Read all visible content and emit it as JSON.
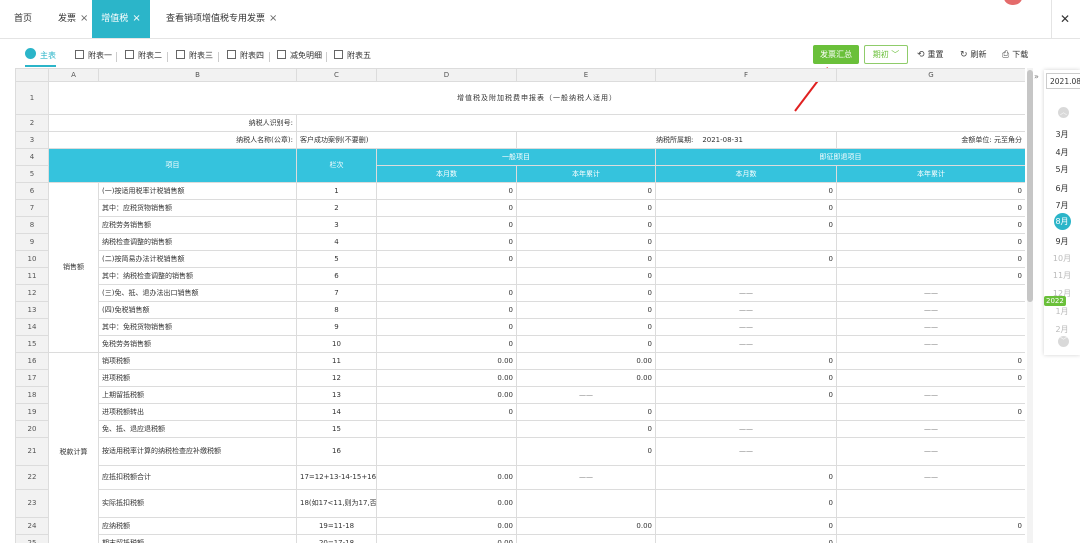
{
  "tabs": [
    {
      "label": "首页",
      "closable": false
    },
    {
      "label": "发票",
      "closable": true
    },
    {
      "label": "增值税",
      "closable": true,
      "active": true
    },
    {
      "label": "查看销项增值税专用发票",
      "closable": true
    }
  ],
  "window_close": "✕",
  "sheet_tabs": [
    "主表",
    "附表一",
    "附表二",
    "附表三",
    "附表四",
    "减免明细",
    "附表五"
  ],
  "actions": {
    "summary": "发票汇总",
    "period": "期初",
    "reset": "重置",
    "refresh": "刷新",
    "download": "下载"
  },
  "col_letters": [
    "A",
    "B",
    "C",
    "D",
    "E",
    "F",
    "G"
  ],
  "form": {
    "title": "增值税及附加税费申报表（一般纳税人适用）",
    "taxpayer_id_label": "纳税人识别号:",
    "taxpayer_name_label": "纳税人名称(公章):",
    "taxpayer_name": "客户成功案例(不要删)",
    "period_label": "纳税所属期:",
    "period": "2021-08-31",
    "unit_label": "金额单位: 元至角分"
  },
  "headers": {
    "item": "项目",
    "col_no": "栏次",
    "general": "一般项目",
    "immediate": "即征即退项目",
    "month": "本月数",
    "year": "本年累计"
  },
  "groups": {
    "sales": "销售额",
    "tax_calc": "税款计算"
  },
  "rows": [
    {
      "n": "6",
      "item": "(一)按适用税率计税销售额",
      "col": "1",
      "d": "0",
      "e": "0",
      "f": "0",
      "g": "0"
    },
    {
      "n": "7",
      "item": "其中：应税货物销售额",
      "col": "2",
      "d": "0",
      "e": "0",
      "f": "0",
      "g": "0"
    },
    {
      "n": "8",
      "item": "应税劳务销售额",
      "col": "3",
      "d": "0",
      "e": "0",
      "f": "0",
      "g": "0"
    },
    {
      "n": "9",
      "item": "纳税检查调整的销售额",
      "col": "4",
      "d": "0",
      "e": "0",
      "f": "",
      "g": "0"
    },
    {
      "n": "10",
      "item": "(二)按简易办法计税销售额",
      "col": "5",
      "d": "0",
      "e": "0",
      "f": "0",
      "g": "0"
    },
    {
      "n": "11",
      "item": "其中：纳税检查调整的销售额",
      "col": "6",
      "d": "",
      "e": "0",
      "f": "",
      "g": "0"
    },
    {
      "n": "12",
      "item": "(三)免、抵、退办法出口销售额",
      "col": "7",
      "d": "0",
      "e": "0",
      "f": "——",
      "g": "——"
    },
    {
      "n": "13",
      "item": "(四)免税销售额",
      "col": "8",
      "d": "0",
      "e": "0",
      "f": "——",
      "g": "——"
    },
    {
      "n": "14",
      "item": "其中：免税货物销售额",
      "col": "9",
      "d": "0",
      "e": "0",
      "f": "——",
      "g": "——"
    },
    {
      "n": "15",
      "item": "免税劳务销售额",
      "col": "10",
      "d": "0",
      "e": "0",
      "f": "——",
      "g": "——"
    },
    {
      "n": "16",
      "item": "销项税额",
      "col": "11",
      "d": "0.00",
      "e": "0.00",
      "f": "0",
      "g": "0"
    },
    {
      "n": "17",
      "item": "进项税额",
      "col": "12",
      "d": "0.00",
      "e": "0.00",
      "f": "0",
      "g": "0"
    },
    {
      "n": "18",
      "item": "上期留抵税额",
      "col": "13",
      "d": "0.00",
      "e": "——",
      "f": "0",
      "g": "——"
    },
    {
      "n": "19",
      "item": "进项税额转出",
      "col": "14",
      "d": "0",
      "e": "0",
      "f": "",
      "g": "0"
    },
    {
      "n": "20",
      "item": "免、抵、退应退税额",
      "col": "15",
      "d": "",
      "e": "0",
      "f": "——",
      "g": "——"
    },
    {
      "n": "21",
      "item": "按适用税率计算的纳税检查应补缴税额",
      "col": "16",
      "d": "",
      "e": "0",
      "f": "——",
      "g": "——"
    },
    {
      "n": "22",
      "item": "应抵扣税额合计",
      "col": "17=12+13-14-15+16",
      "d": "0.00",
      "e": "——",
      "f": "0",
      "g": "——"
    },
    {
      "n": "23",
      "item": "实际抵扣税额",
      "col": "18(如17<11,则为17,否则为11)",
      "d": "0.00",
      "e": "",
      "f": "0",
      "g": ""
    },
    {
      "n": "24",
      "item": "应纳税额",
      "col": "19=11-18",
      "d": "0.00",
      "e": "0.00",
      "f": "0",
      "g": "0"
    },
    {
      "n": "25",
      "item": "期末留抵税额",
      "col": "20=17-18",
      "d": "0.00",
      "e": "——",
      "f": "0",
      "g": "——"
    }
  ],
  "date_panel": {
    "current": "2021.08",
    "months": [
      "3月",
      "4月",
      "5月",
      "6月",
      "7月",
      "8月",
      "9月",
      "10月",
      "11月",
      "12月",
      "1月",
      "2月"
    ],
    "selected": "8月",
    "year_badge": "2022"
  }
}
